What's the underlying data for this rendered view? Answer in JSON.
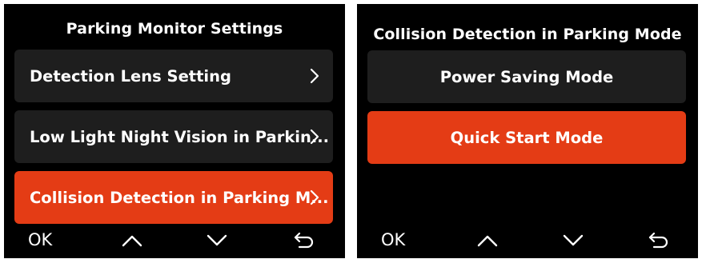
{
  "left_screen": {
    "title": "Parking Monitor Settings",
    "items": [
      {
        "label": "Detection Lens Setting",
        "selected": false
      },
      {
        "label": "Low Light Night Vision in Parkin...",
        "selected": false
      },
      {
        "label": "Collision Detection in Parking M...",
        "selected": true
      }
    ],
    "footer": {
      "ok_label": "OK",
      "icons": [
        "chevron-up-icon",
        "chevron-down-icon",
        "return-arrow-icon"
      ]
    }
  },
  "right_screen": {
    "title": "Collision Detection in Parking Mode",
    "options": [
      {
        "label": "Power Saving Mode",
        "selected": false
      },
      {
        "label": "Quick Start Mode",
        "selected": true
      }
    ],
    "footer": {
      "ok_label": "OK",
      "icons": [
        "chevron-up-icon",
        "chevron-down-icon",
        "return-arrow-icon"
      ]
    }
  },
  "colors": {
    "screen_bg": "#000000",
    "item_bg": "#1e1e1e",
    "selected_bg": "#e43c15",
    "text": "#ffffff"
  }
}
